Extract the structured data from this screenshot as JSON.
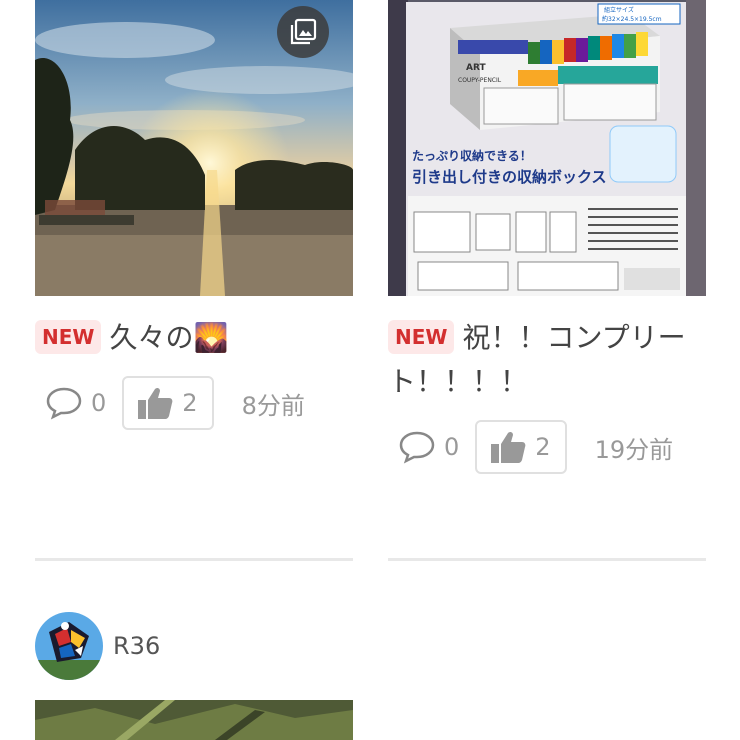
{
  "posts": [
    {
      "badge": "NEW",
      "title": "久々の",
      "title_emoji": "🌄",
      "comments": "0",
      "likes": "2",
      "time": "8分前"
    },
    {
      "badge": "NEW",
      "title": "祝！！コンプリート！！！！",
      "comments": "0",
      "likes": "2",
      "time": "19分前"
    }
  ],
  "box_photo_text": {
    "brand": "ART",
    "sub_brand": "COUPY-PENCIL",
    "line1": "たっぷり収納できる！",
    "line2": "引き出し付きの収納ボックス",
    "size_label": "組立サイズ",
    "size_value": "約32×24.5×19.5cm"
  },
  "next_post": {
    "username": "R36"
  },
  "icons": {
    "gallery": "gallery-icon",
    "comment": "comment-icon",
    "like": "thumbs-up-icon"
  },
  "colors": {
    "badge_bg": "#fde8e8",
    "badge_text": "#d32f2f",
    "meta_text": "#999999"
  }
}
